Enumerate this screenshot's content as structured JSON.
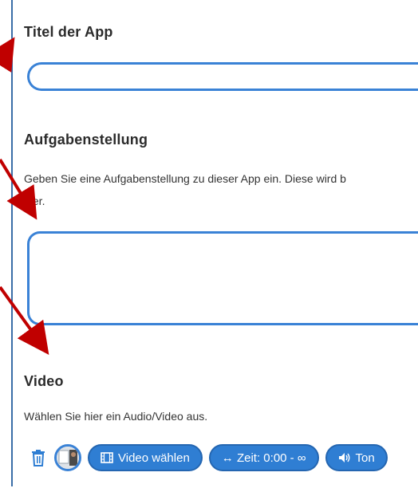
{
  "app_title": {
    "label": "Titel der App",
    "value": ""
  },
  "task": {
    "label": "Aufgabenstellung",
    "desc_line1": "Geben Sie eine Aufgabenstellung zu dieser App ein. Diese wird b",
    "desc_line2": "leer.",
    "value": ""
  },
  "video": {
    "label": "Video",
    "desc": "Wählen Sie hier ein Audio/Video aus.",
    "buttons": {
      "choose": "Video wählen",
      "time": "↔ Zeit: 0:00 - ∞",
      "sound": "Ton"
    }
  },
  "colors": {
    "accent": "#2f7ed3",
    "border": "#3a82d6",
    "annotation_arrow": "#c00000"
  }
}
